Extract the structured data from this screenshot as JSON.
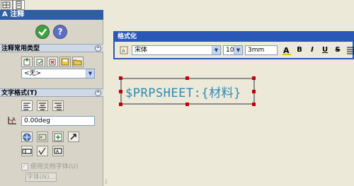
{
  "panel": {
    "title": "注释",
    "common_types_section": "注释常用类型",
    "common_type_select": "<无>",
    "text_format_section": "文字格式(T)",
    "angle_value": "0.00deg",
    "use_doc_font_label": "使用文档字体(U)",
    "font_button": "字体(N)..."
  },
  "format_toolbar": {
    "title": "格式化",
    "font_name": "宋体",
    "font_size": "10",
    "height_value": "3mm",
    "bold_label": "B",
    "italic_label": "I",
    "underline_label": "U",
    "strike_label": "S"
  },
  "note": {
    "text": "$PRPSHEET:{材料}"
  },
  "colors": {
    "title_bar": "#2a58b8",
    "handle": "#c0000a",
    "note_text": "#2f8ab4"
  }
}
